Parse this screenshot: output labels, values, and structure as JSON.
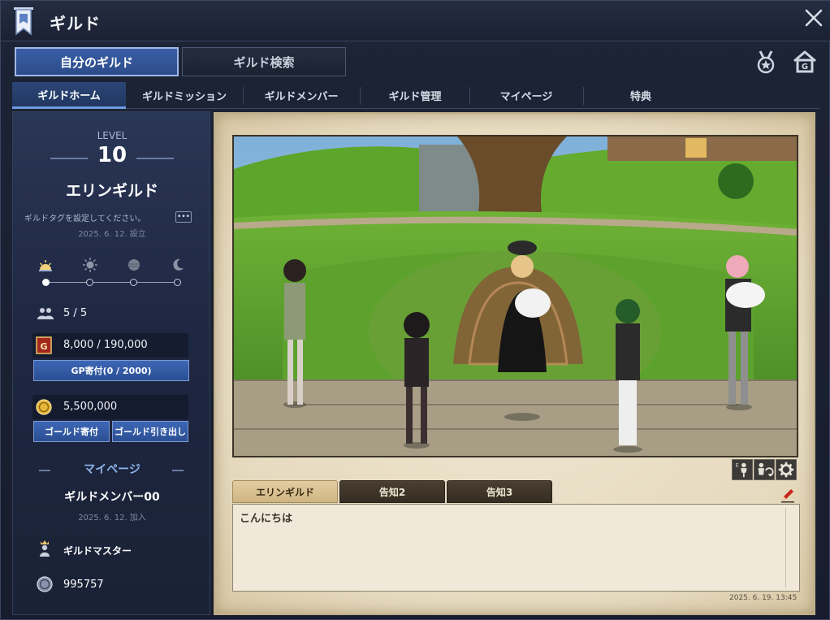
{
  "window": {
    "title": "ギルド"
  },
  "top_tabs": [
    {
      "label": "自分のギルド",
      "active": true
    },
    {
      "label": "ギルド検索",
      "active": false
    }
  ],
  "sub_tabs": [
    {
      "label": "ギルドホーム",
      "active": true
    },
    {
      "label": "ギルドミッション",
      "active": false
    },
    {
      "label": "ギルドメンバー",
      "active": false
    },
    {
      "label": "ギルド管理",
      "active": false
    },
    {
      "label": "マイページ",
      "active": false
    },
    {
      "label": "特典",
      "active": false
    }
  ],
  "guild": {
    "level_label": "LEVEL",
    "level": "10",
    "name": "エリンギルド",
    "tag_prompt": "ギルドタグを設定してください。",
    "founded": "2025. 6. 12. 設立",
    "members": "5 / 5",
    "gp": "8,000 / 190,000",
    "gp_donate_label": "GP寄付(0 / 2000)",
    "gold": "5,500,000",
    "gold_donate_label": "ゴールド寄付",
    "gold_withdraw_label": "ゴールド引き出し"
  },
  "weather": {
    "icons": [
      "sunrise-icon",
      "sun-icon",
      "cloudy-icon",
      "moon-icon"
    ],
    "selected_index": 0
  },
  "mypage": {
    "title": "マイページ",
    "member_name": "ギルドメンバー00",
    "joined": "2025. 6. 12. 加入",
    "rank": "ギルドマスター",
    "points": "995757"
  },
  "notice": {
    "tabs": [
      {
        "label": "エリンギルド",
        "active": true
      },
      {
        "label": "告知2",
        "active": false
      },
      {
        "label": "告知3",
        "active": false
      }
    ],
    "content": "こんにちは",
    "timestamp": "2025. 6. 19. 13:45"
  },
  "colors": {
    "accent_blue": "#3d66b6",
    "parchment": "#e6dabf",
    "tab_active_gold": "#cfb583",
    "window_bg": "#1d2436"
  }
}
